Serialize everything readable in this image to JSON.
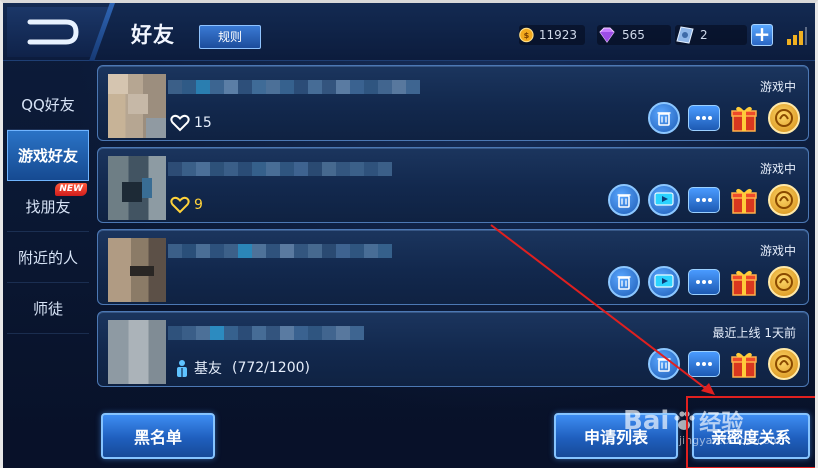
{
  "header": {
    "title": "好友",
    "rules_label": "规则",
    "gold": "11923",
    "diamonds": "565",
    "vouchers": "2",
    "add_label": "+"
  },
  "sidebar": {
    "items": [
      {
        "label": "QQ好友",
        "active": false
      },
      {
        "label": "游戏好友",
        "active": true
      },
      {
        "label": "找朋友",
        "badge": "NEW"
      },
      {
        "label": "附近的人"
      },
      {
        "label": "师徒"
      }
    ]
  },
  "friends": [
    {
      "status": "游戏中",
      "intimacy": "15",
      "intimacy_color": "#ffffff",
      "actions": [
        "delete",
        "chat",
        "gift",
        "medal"
      ]
    },
    {
      "status": "游戏中",
      "intimacy": "9",
      "intimacy_color": "#ffd23a",
      "actions": [
        "delete",
        "spectate",
        "chat",
        "gift",
        "medal"
      ]
    },
    {
      "status": "游戏中",
      "actions": [
        "delete",
        "spectate",
        "chat",
        "gift",
        "medal"
      ]
    },
    {
      "status": "最近上线  1天前",
      "relation": "基友",
      "relation_count": "(772/1200)",
      "actions": [
        "delete",
        "chat",
        "gift",
        "medal"
      ]
    }
  ],
  "bottom": {
    "blacklist": "黑名单",
    "requests": "申请列表",
    "intimacy_relations": "亲密度关系"
  },
  "watermark": {
    "brand": "Bai",
    "brand_suffix": "经验",
    "url": "jingyan.baidu.com"
  },
  "colors": {
    "accent": "#2a73c6",
    "annotation": "#e0201f",
    "gold": "#ffd23a"
  }
}
